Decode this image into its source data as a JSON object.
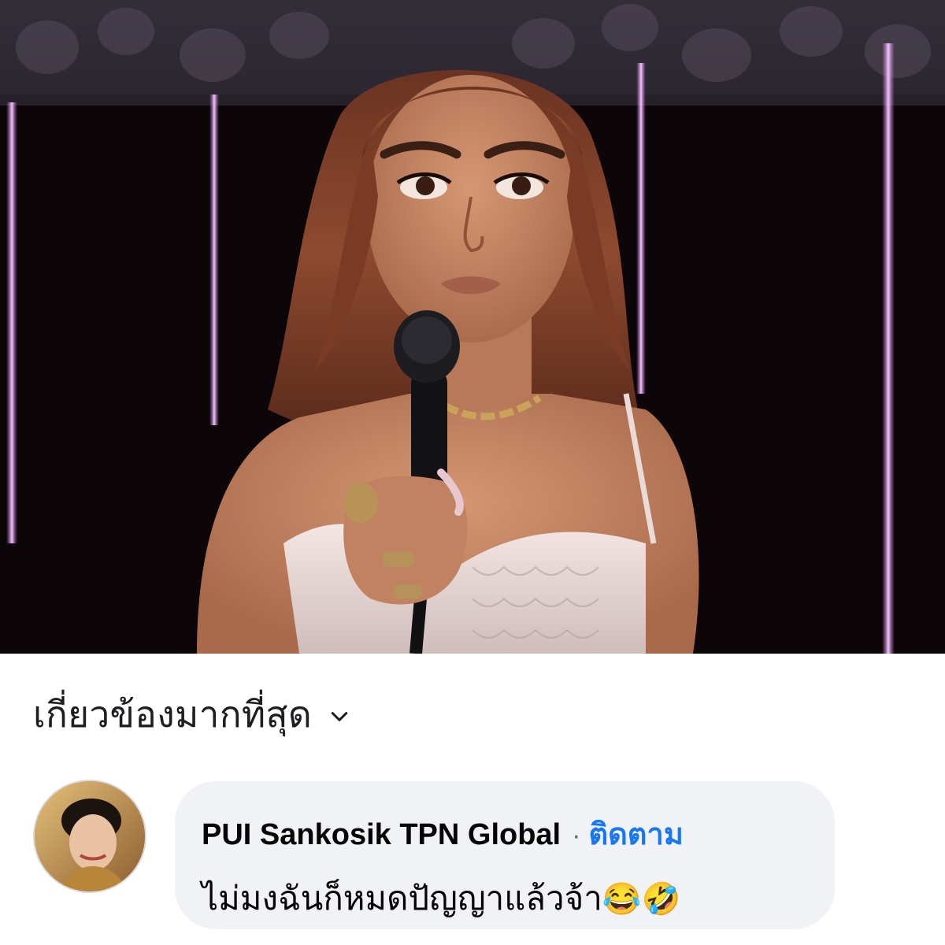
{
  "sort": {
    "label": "เกี่ยวข้องมากที่สุด",
    "icon": "chevron-down-icon"
  },
  "comment": {
    "author": "PUI Sankosik TPN Global",
    "separator": "·",
    "follow_label": "ติดตาม",
    "text": "ไม่มงฉันก็หมดปัญญาแล้วจ้า",
    "emojis": "😂🤣"
  },
  "colors": {
    "link": "#1877f2",
    "bubble": "#f0f2f5",
    "text": "#050505"
  }
}
